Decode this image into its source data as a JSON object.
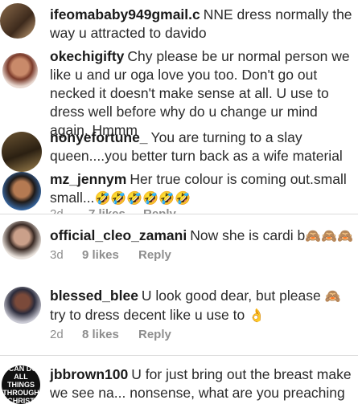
{
  "comments": [
    {
      "username": "ifeomababy949gmail.c",
      "text": "NNE dress normally the way u attracted to davido"
    },
    {
      "username": "okechigifty",
      "text": "Chy please be ur normal person we like u and ur oga  love you too. Don't go out necked it doesn't make sense at all. U use to dress well before why do u change ur mind again. Hmmm"
    },
    {
      "username": "nonyefortune_",
      "text": "You are turning to a slay queen....you better turn back as a wife material"
    },
    {
      "username": "mz_jennym",
      "text": "Her true colour is coming out.small small...",
      "emojis": "🤣🤣🤣🤣🤣🤣",
      "time": "2d",
      "likes": "7 likes",
      "reply": "Reply"
    },
    {
      "username": "official_cleo_zamani",
      "text": "Now she is cardi b",
      "emojis": "🙈🙈🙈",
      "time": "3d",
      "likes": "9 likes",
      "reply": "Reply"
    },
    {
      "username": "blessed_blee",
      "text": "U look good dear, but please",
      "emoji_a": "🙈",
      "text2": "try to dress decent like u use to",
      "emoji_b": "👌",
      "time": "2d",
      "likes": "8 likes",
      "reply": "Reply"
    },
    {
      "username": "jbbrown100",
      "text": "U for just bring out the breast make we see na... nonsense, what are you preaching",
      "avatar_text": "I CAN DO ALL THINGS THROUGH CHRIST"
    }
  ],
  "colors": {
    "text": "#262626",
    "meta": "#8e8e8e",
    "divider": "#dbdbdb"
  }
}
